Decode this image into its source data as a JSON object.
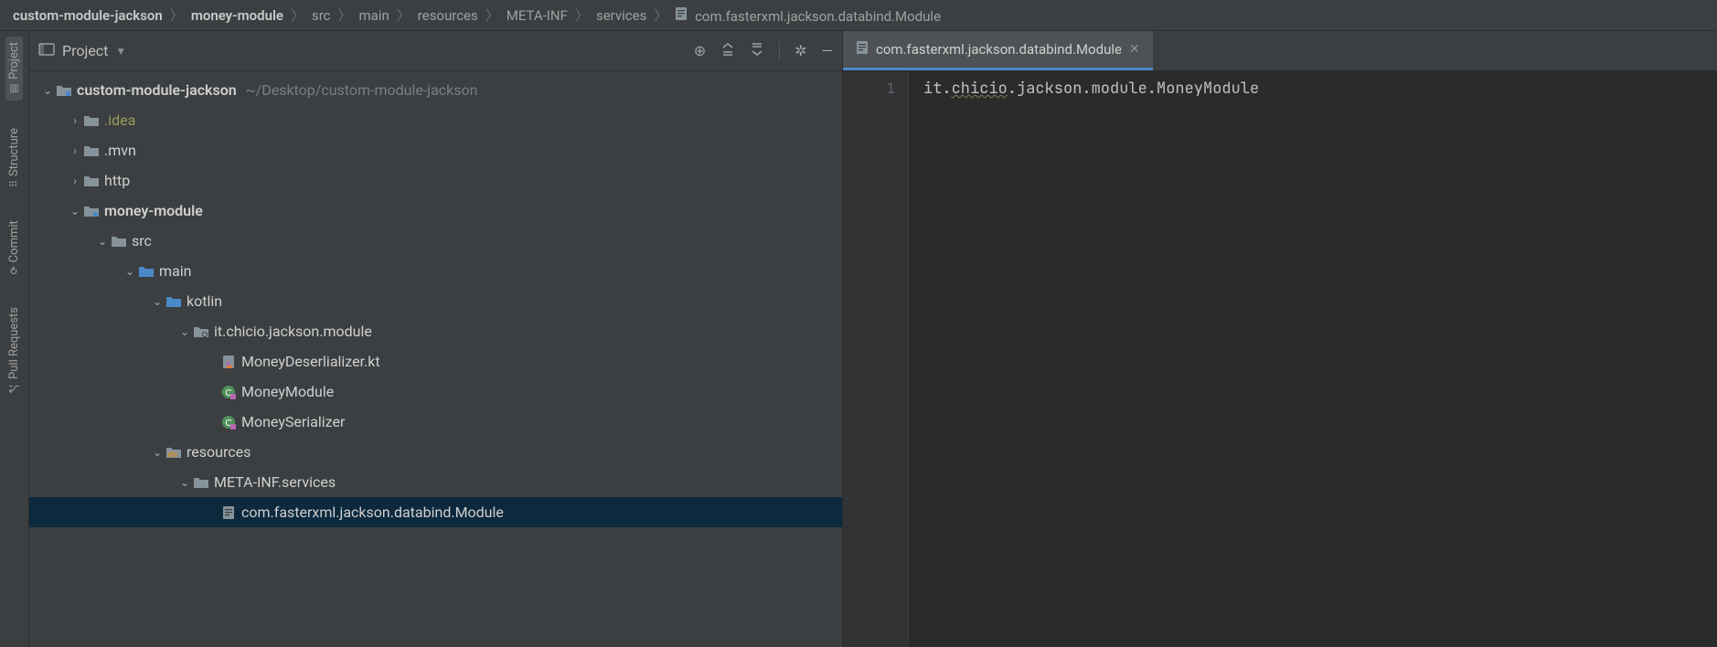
{
  "breadcrumb": {
    "items": [
      {
        "label": "custom-module-jackson",
        "bold": true
      },
      {
        "label": "money-module",
        "bold": true
      },
      {
        "label": "src"
      },
      {
        "label": "main"
      },
      {
        "label": "resources"
      },
      {
        "label": "META-INF"
      },
      {
        "label": "services"
      },
      {
        "label": "com.fasterxml.jackson.databind.Module",
        "file": true
      }
    ]
  },
  "toolStrip": {
    "tabs": [
      {
        "label": "Project",
        "active": true
      },
      {
        "label": "Structure"
      },
      {
        "label": "Commit"
      },
      {
        "label": "Pull Requests"
      }
    ]
  },
  "projectPanel": {
    "title": "Project",
    "rootHint": "~/Desktop/custom-module-jackson",
    "tree": [
      {
        "depth": 0,
        "exp": "down",
        "icon": "module",
        "label": "custom-module-jackson",
        "bold": true,
        "hint": "~/Desktop/custom-module-jackson"
      },
      {
        "depth": 1,
        "exp": "right",
        "icon": "folder-gray",
        "label": ".idea",
        "idea": true
      },
      {
        "depth": 1,
        "exp": "right",
        "icon": "folder-gray",
        "label": ".mvn"
      },
      {
        "depth": 1,
        "exp": "right",
        "icon": "folder-gray",
        "label": "http"
      },
      {
        "depth": 1,
        "exp": "down",
        "icon": "module",
        "label": "money-module",
        "bold": true
      },
      {
        "depth": 2,
        "exp": "down",
        "icon": "folder-gray",
        "label": "src"
      },
      {
        "depth": 3,
        "exp": "down",
        "icon": "folder-blue",
        "label": "main"
      },
      {
        "depth": 4,
        "exp": "down",
        "icon": "folder-blue",
        "label": "kotlin"
      },
      {
        "depth": 5,
        "exp": "down",
        "icon": "package",
        "label": "it.chicio.jackson.module"
      },
      {
        "depth": 6,
        "exp": "",
        "icon": "kt-file",
        "label": "MoneyDeserlializer.kt"
      },
      {
        "depth": 6,
        "exp": "",
        "icon": "kt-class",
        "label": "MoneyModule"
      },
      {
        "depth": 6,
        "exp": "",
        "icon": "kt-class",
        "label": "MoneySerializer"
      },
      {
        "depth": 4,
        "exp": "down",
        "icon": "resources",
        "label": "resources"
      },
      {
        "depth": 5,
        "exp": "down",
        "icon": "folder-gray",
        "label": "META-INF.services"
      },
      {
        "depth": 6,
        "exp": "",
        "icon": "text-file",
        "label": "com.fasterxml.jackson.databind.Module",
        "selected": true
      }
    ]
  },
  "editor": {
    "tab": {
      "label": "com.fasterxml.jackson.databind.Module"
    },
    "lineNumber": "1",
    "codeParts": {
      "p1": "it.",
      "squig": "chicio",
      "p2": ".jackson.module.MoneyModule"
    }
  }
}
